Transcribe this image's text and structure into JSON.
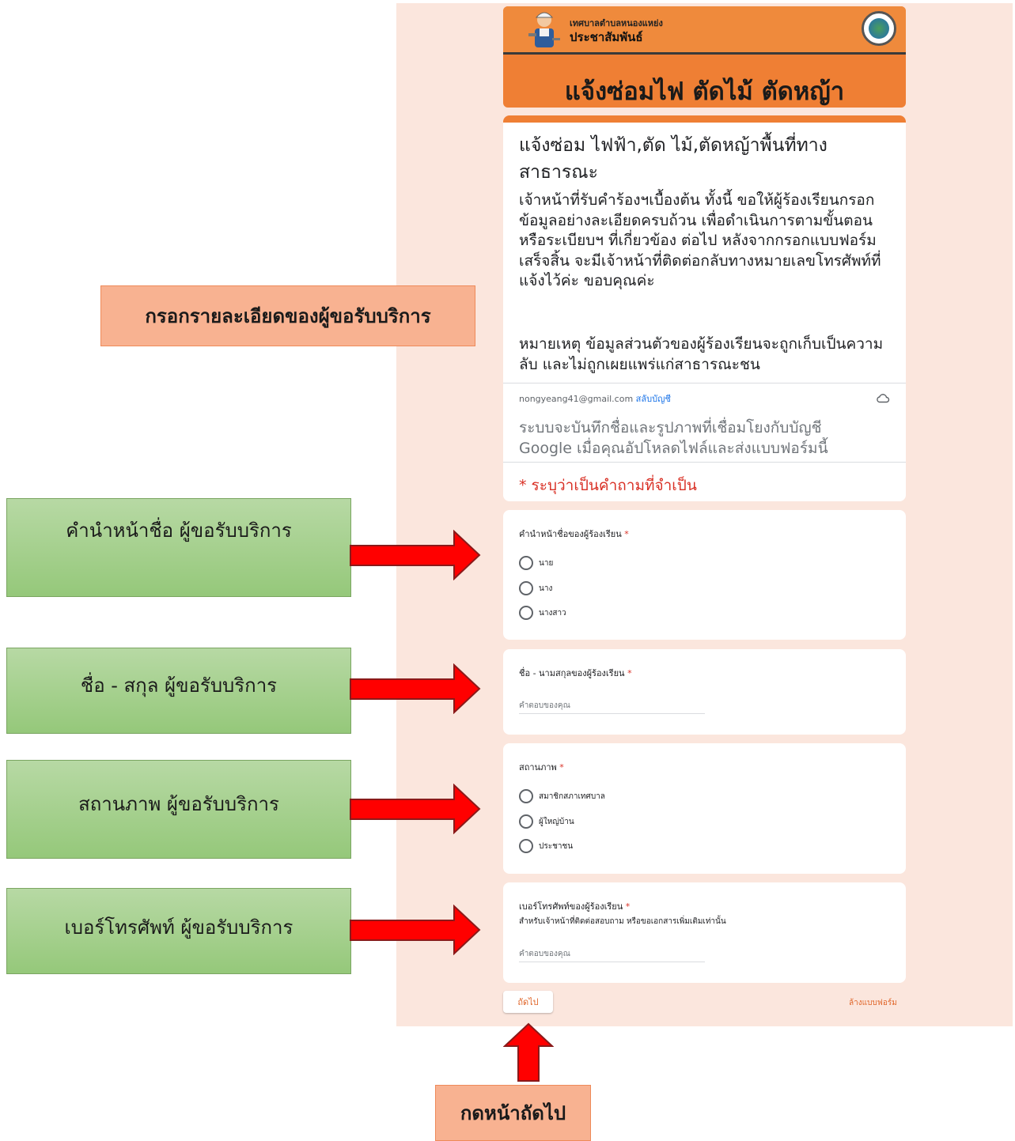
{
  "banner": {
    "org_small": "เทศบาลตำบลหนองแหย่ง",
    "org_big": "ประชาสัมพันธ์",
    "title": "แจ้งซ่อมไฟ ตัดไม้ ตัดหญ้า"
  },
  "form_header": {
    "title": "แจ้งซ่อม ไฟฟ้า,ตัด ไม้,ตัดหญ้าพื้นที่ทางสาธารณะ",
    "description": "เจ้าหน้าที่รับคำร้องฯเบื้องต้น ทั้งนี้ ขอให้ผู้ร้องเรียนกรอกข้อมูลอย่างละเอียดครบถ้วน เพื่อดำเนินการตามขั้นตอนหรือระเบียบฯ ที่เกี่ยวข้อง ต่อไป หลังจากกรอกแบบฟอร์มเสร็จสิ้น จะมีเจ้าหน้าที่ติดต่อกลับทางหมายเลขโทรศัพท์ที่แจ้งไว้ค่ะ ขอบคุณค่ะ",
    "note": "หมายเหตุ ข้อมูลส่วนตัวของผู้ร้องเรียนจะถูกเก็บเป็นความลับ และไม่ถูกเผยแพร่แก่สาธารณะชน",
    "email": "nongyeang41@gmail.com",
    "switch_account": "สลับบัญชี",
    "info": "ระบบจะบันทึกชื่อและรูปภาพที่เชื่อมโยงกับบัญชี Google เมื่อคุณอัปโหลดไฟล์และส่งแบบฟอร์มนี้",
    "required_note": "* ระบุว่าเป็นคำถามที่จำเป็น"
  },
  "questions": {
    "prefix": {
      "title": "คำนำหน้าชื่อของผู้ร้องเรียน",
      "options": [
        "นาย",
        "นาง",
        "นางสาว"
      ]
    },
    "name": {
      "title": "ชื่อ - นามสกุลของผู้ร้องเรียน",
      "placeholder": "คำตอบของคุณ"
    },
    "status": {
      "title": "สถานภาพ",
      "options": [
        "สมาชิกสภาเทศบาล",
        "ผู้ใหญ่บ้าน",
        "ประชาชน"
      ]
    },
    "phone": {
      "title": "เบอร์โทรศัพท์ของผู้ร้องเรียน",
      "help": "สำหรับเจ้าหน้าที่ติดต่อสอบถาม หรือขอเอกสารเพิ่มเติมเท่านั้น",
      "placeholder": "คำตอบของคุณ"
    },
    "required_mark": "*"
  },
  "footer": {
    "next": "ถัดไป",
    "clear": "ล้างแบบฟอร์ม"
  },
  "annotations": {
    "details": "กรอกรายละเอียดของผู้ขอรับบริการ",
    "prefix": "คำนำหน้าชื่อ ผู้ขอรับบริการ",
    "name": "ชื่อ - สกุล ผู้ขอรับบริการ",
    "status": "สถานภาพ ผู้ขอรับบริการ",
    "phone": "เบอร์โทรศัพท์ ผู้ขอรับบริการ",
    "next": "กดหน้าถัดไป"
  },
  "colors": {
    "accent": "#ef7f34",
    "page_bg": "#fbe6dd",
    "arrow": "#ff0000",
    "required": "#d93025"
  }
}
